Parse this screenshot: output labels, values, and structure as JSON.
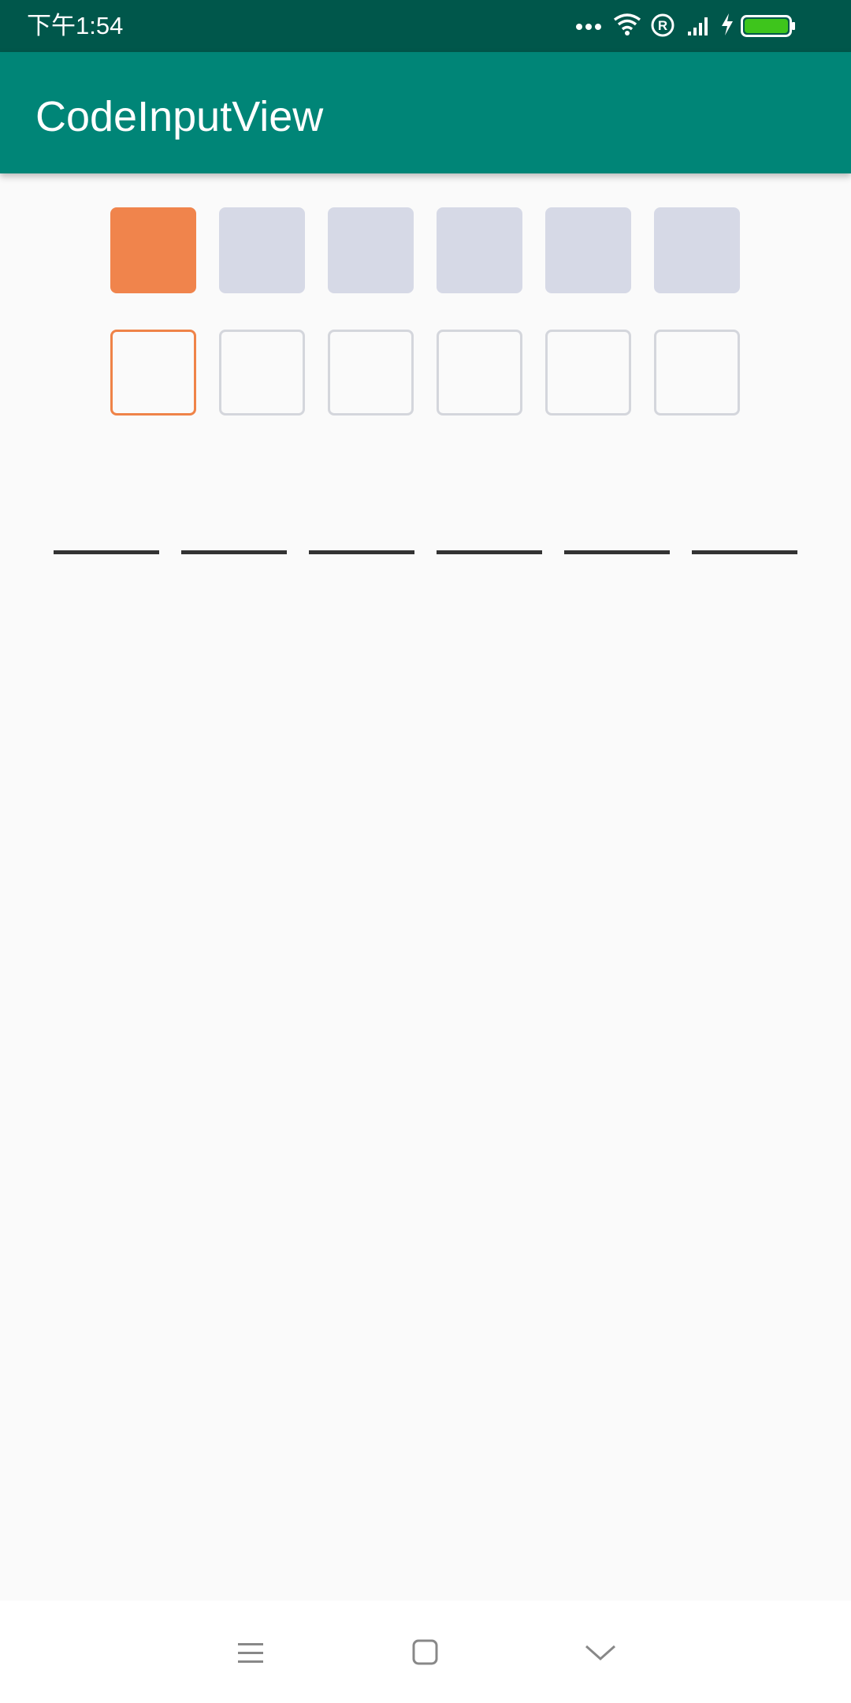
{
  "status_bar": {
    "time": "下午1:54",
    "icons": [
      "more-dots-icon",
      "wifi-icon",
      "registered-icon",
      "signal-icon",
      "charging-icon",
      "battery-icon"
    ],
    "battery_color": "#3ec51c"
  },
  "app_bar": {
    "title": "CodeInputView",
    "color": "#008577"
  },
  "code_inputs": {
    "filled_boxes": {
      "count": 6,
      "active_index": 0,
      "active_color": "#f0844c",
      "inactive_color": "#d6d9e6"
    },
    "outline_boxes": {
      "count": 6,
      "active_index": 0,
      "active_color": "#ef8348",
      "inactive_color": "#d4d6dc"
    },
    "underline_fields": {
      "count": 6,
      "color": "#333333"
    }
  },
  "nav_bar": {
    "buttons": [
      "menu-icon",
      "home-icon",
      "back-icon"
    ]
  }
}
